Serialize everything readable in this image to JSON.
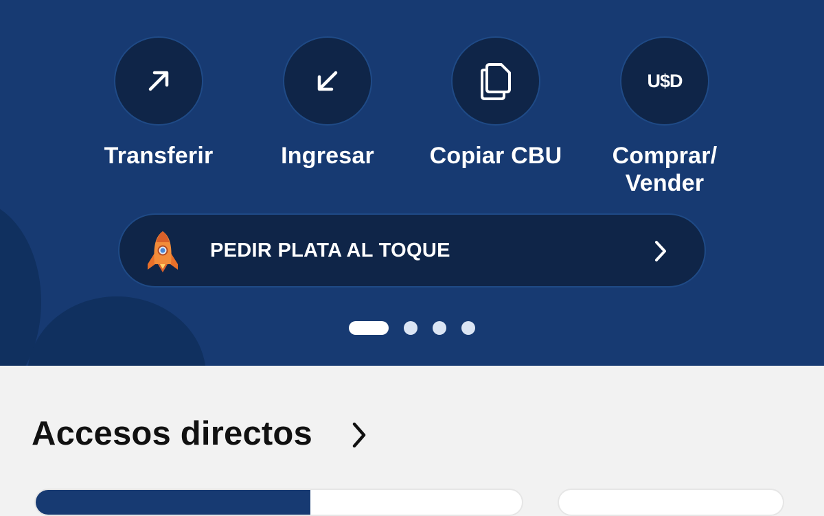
{
  "actions": [
    {
      "label": "Transferir",
      "icon": "arrow-up-right-icon"
    },
    {
      "label": "Ingresar",
      "icon": "arrow-down-left-icon"
    },
    {
      "label": "Copiar CBU",
      "icon": "copy-icon"
    },
    {
      "label_line1": "Comprar/",
      "label_line2": "Vender",
      "icon": "usd-icon",
      "icon_text": "U$D"
    }
  ],
  "promo": {
    "label": "PEDIR PLATA AL TOQUE",
    "icon": "rocket-icon"
  },
  "carousel": {
    "pages": 4,
    "active_index": 0
  },
  "shortcuts": {
    "title": "Accesos directos"
  },
  "colors": {
    "hero_bg": "#173a72",
    "button_bg": "#0f2548",
    "page_bg": "#f2f2f2"
  }
}
